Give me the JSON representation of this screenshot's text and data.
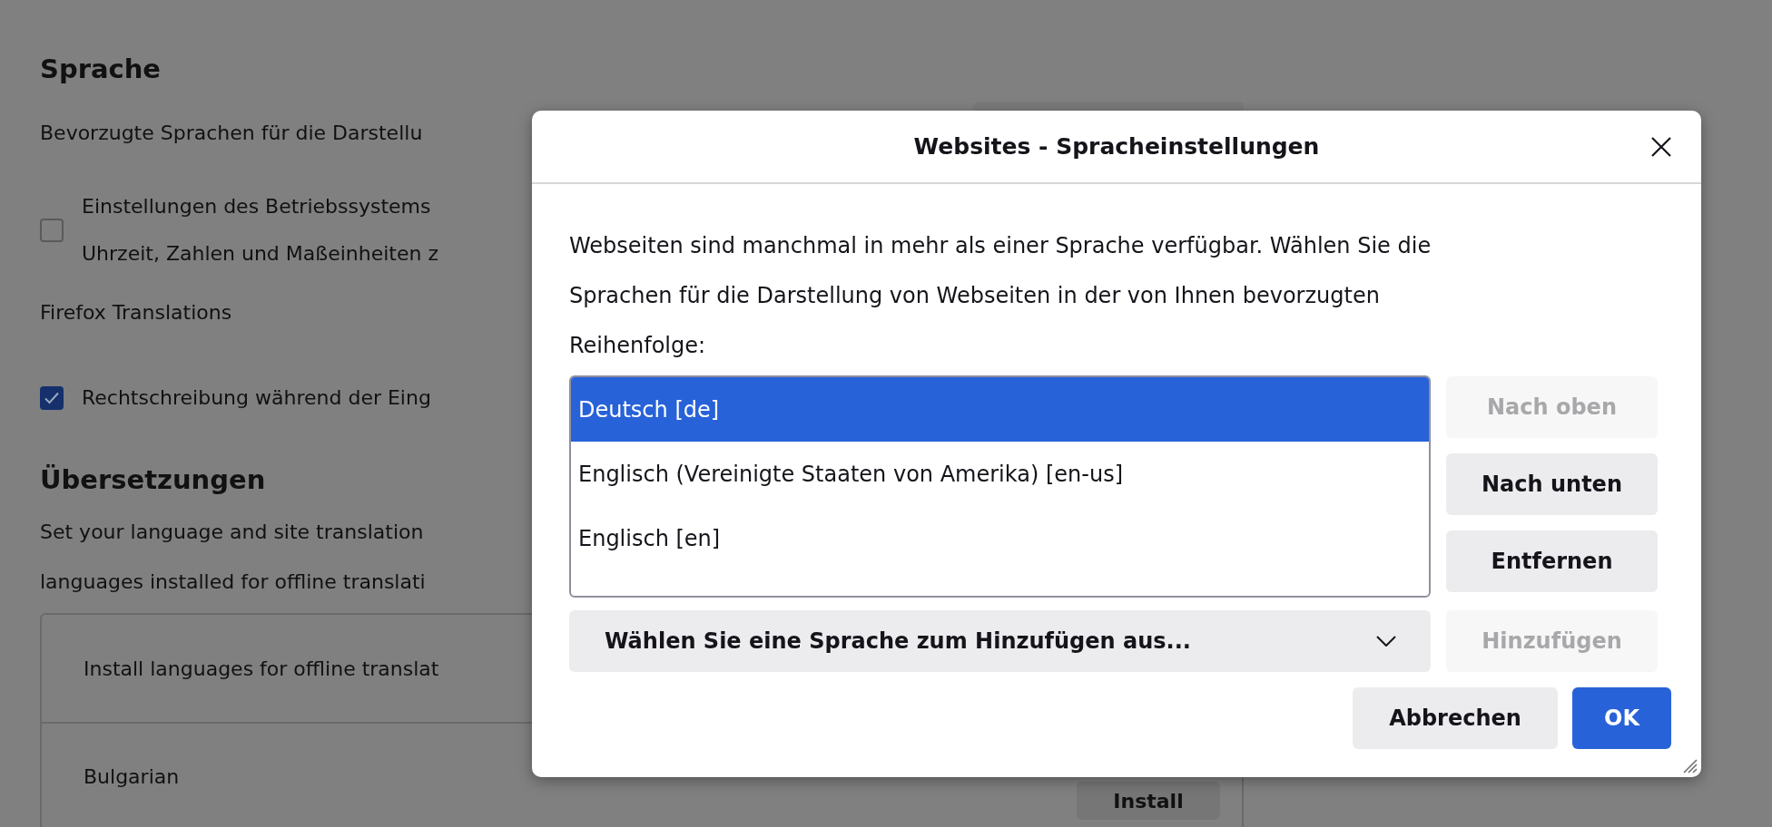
{
  "page": {
    "language_heading": "Sprache",
    "preferred_text": "Bevorzugte Sprachen für die Darstellu",
    "os_settings": {
      "label_lines": [
        "Einstellungen des Betriebssystems",
        "Uhrzeit, Zahlen und Maßeinheiten z"
      ],
      "checked": false
    },
    "translations_label": "Firefox Translations",
    "spellcheck": {
      "label": "Rechtschreibung während der Eing",
      "checked": true
    },
    "translations_heading": "Übersetzungen",
    "translations_text_lines": [
      "Set your language and site translation",
      "languages installed for offline translati"
    ],
    "offline_rows": [
      {
        "label": "Install languages for offline translat"
      },
      {
        "label": "Bulgarian",
        "button": "Install"
      }
    ]
  },
  "dialog": {
    "title": "Websites - Spracheinstellungen",
    "description": "Webseiten sind manchmal in mehr als einer Sprache verfügbar. Wählen Sie die Sprachen für die Darstellung von Webseiten in der von Ihnen bevorzugten Reihenfolge:",
    "languages": [
      {
        "label": "Deutsch [de]",
        "selected": true
      },
      {
        "label": "Englisch (Vereinigte Staaten von Amerika) [en-us]",
        "selected": false
      },
      {
        "label": "Englisch [en]",
        "selected": false
      }
    ],
    "side_buttons": [
      {
        "label": "Nach oben",
        "disabled": true
      },
      {
        "label": "Nach unten",
        "disabled": false
      },
      {
        "label": "Entfernen",
        "disabled": false
      }
    ],
    "language_select": "Wählen Sie eine Sprache zum Hinzufügen aus...",
    "add_button": {
      "label": "Hinzufügen",
      "disabled": true
    },
    "footer_buttons": [
      {
        "label": "Abbrechen",
        "kind": "secondary"
      },
      {
        "label": "OK",
        "kind": "primary"
      }
    ]
  }
}
